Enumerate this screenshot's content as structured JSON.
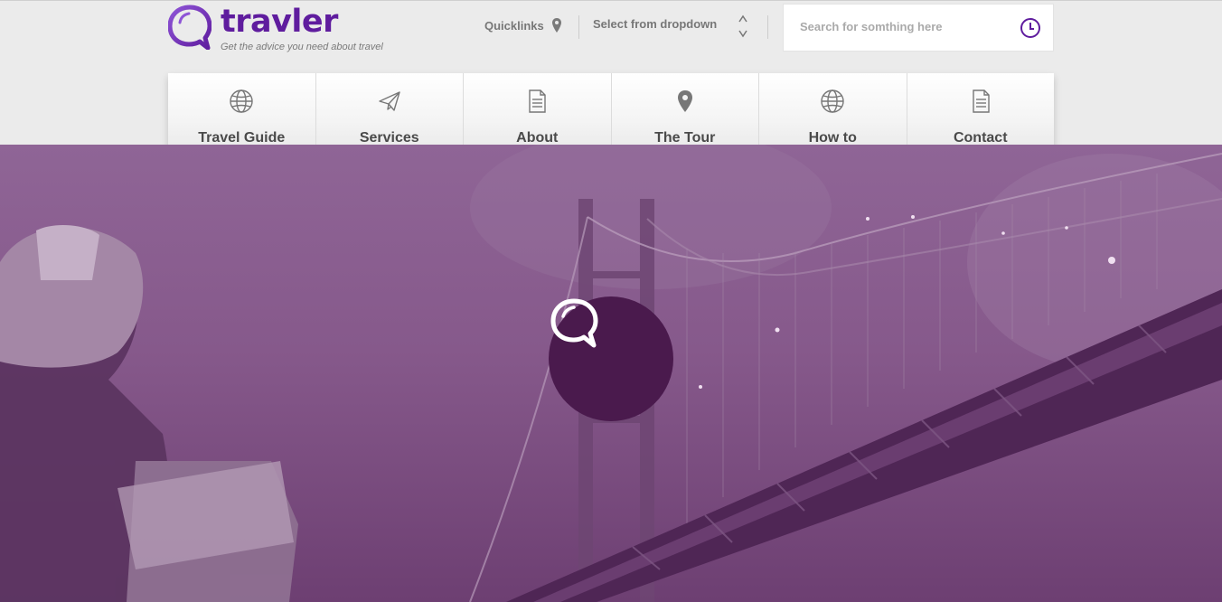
{
  "brand": {
    "name": "travler",
    "tagline": "Get the advice you need about travel"
  },
  "topbar": {
    "quicklinks_label": "Quicklinks",
    "dropdown_label": "Select from dropdown"
  },
  "search": {
    "placeholder": "Search for somthing here"
  },
  "nav": {
    "items": [
      {
        "label": "Travel Guide",
        "icon": "globe-icon"
      },
      {
        "label": "Services",
        "icon": "paper-plane-icon"
      },
      {
        "label": "About",
        "icon": "document-icon"
      },
      {
        "label": "The Tour",
        "icon": "map-pin-icon"
      },
      {
        "label": "How to",
        "icon": "globe-icon"
      },
      {
        "label": "Contact",
        "icon": "document-icon"
      }
    ]
  },
  "hero": {
    "badge_icon": "speech-bubble-icon"
  },
  "colors": {
    "accent": "#5f1c9e",
    "hero_overlay": "#86598b",
    "badge": "#4a1a4d"
  }
}
